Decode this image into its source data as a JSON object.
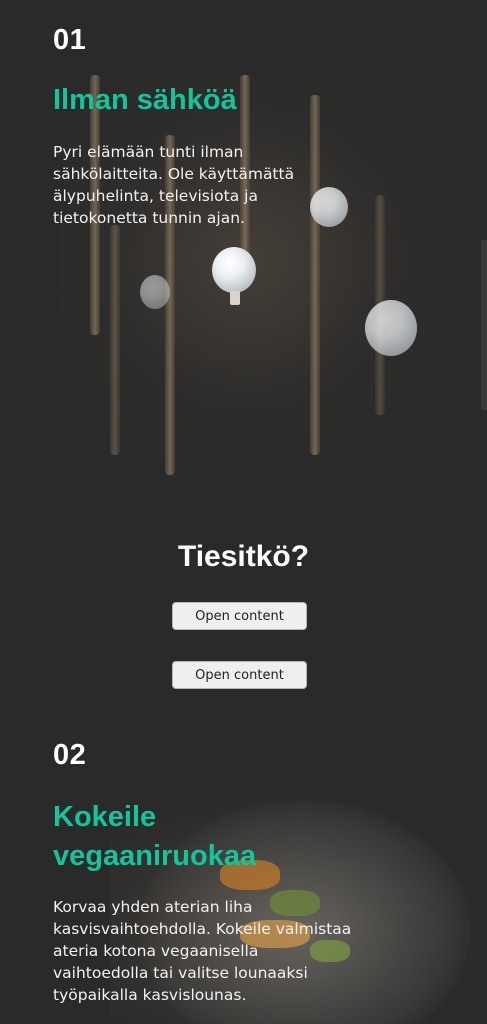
{
  "section1": {
    "number": "01",
    "title": "Ilman sähköä",
    "body_lines": [
      "Pyri elämään tunti ilman",
      "sähkölaitteita. Ole käyttämättä",
      "älypuhelinta, televisiota ja",
      "tietokonetta tunnin ajan."
    ]
  },
  "did_you_know": {
    "heading": "Tiesitkö?",
    "buttons": [
      "Open content",
      "Open content"
    ]
  },
  "section2": {
    "number": "02",
    "title_lines": [
      "Kokeile",
      "vegaaniruokaa"
    ],
    "body_lines": [
      "Korvaa yhden aterian liha",
      "kasvisvaihtoehdolla. Kokeile valmistaa",
      "ateria kotona vegaanisella",
      "vaihtoedolla tai valitse lounaaksi",
      "työpaikalla kasvislounas."
    ]
  },
  "colors": {
    "background": "#2a2a2a",
    "accent": "#14c49b",
    "text": "#ffffff"
  }
}
